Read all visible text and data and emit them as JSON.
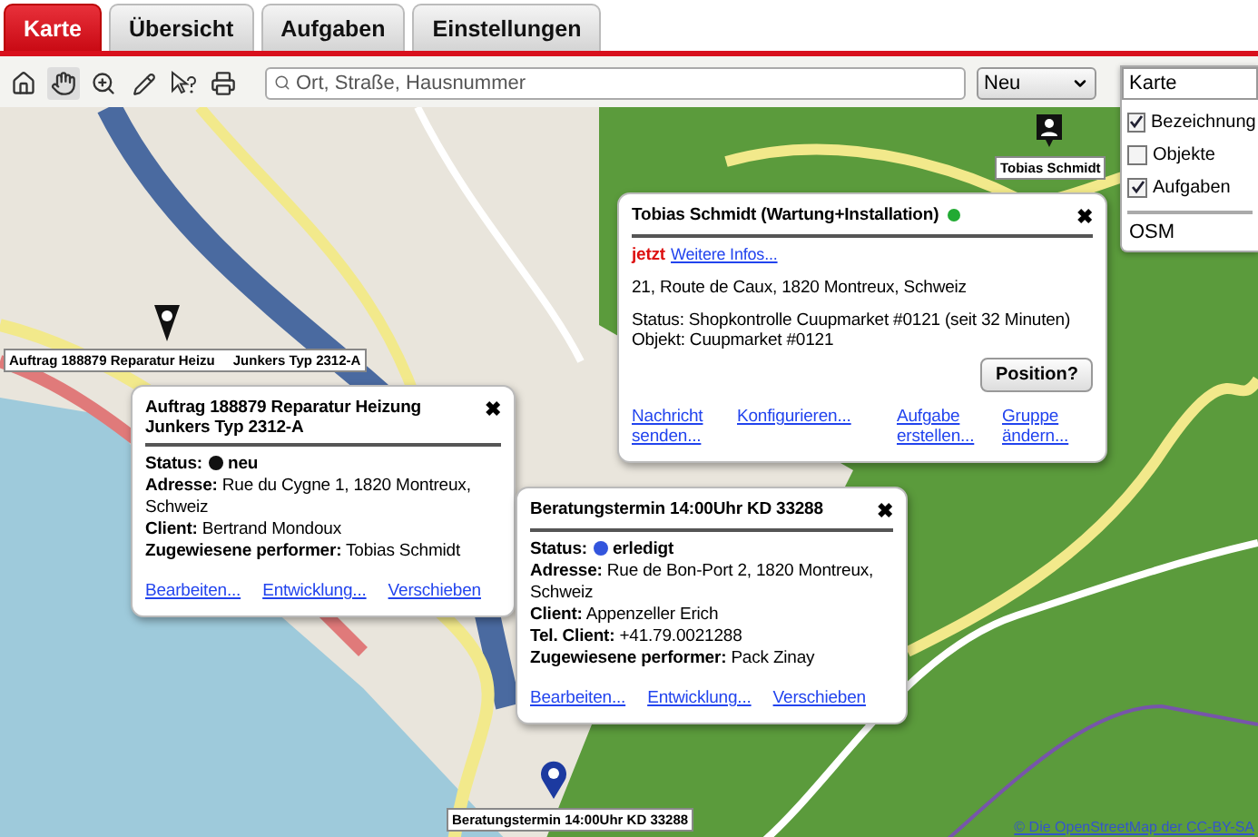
{
  "tabs": [
    {
      "label": "Karte",
      "selected": true
    },
    {
      "label": "Übersicht",
      "selected": false
    },
    {
      "label": "Aufgaben",
      "selected": false
    },
    {
      "label": "Einstellungen",
      "selected": false
    }
  ],
  "toolbar": {
    "search": {
      "placeholder": "Ort, Straße, Hausnummer"
    },
    "new_dropdown": "Neu"
  },
  "layers": {
    "map_select": "Karte",
    "options": [
      {
        "label": "Bezeichnung",
        "checked": true
      },
      {
        "label": "Objekte",
        "checked": false
      },
      {
        "label": "Aufgaben",
        "checked": true
      }
    ],
    "base_layer": "OSM"
  },
  "markers": [
    {
      "kind": "task",
      "label_parts": [
        "Auftrag 188879 Reparatur Heizu",
        "Junkers Typ 2312-A"
      ]
    },
    {
      "kind": "person",
      "label_parts": [
        "Tobias Schmidt"
      ]
    },
    {
      "kind": "done",
      "label_parts": [
        "Beratungstermin 14:00Uhr KD 33288"
      ]
    }
  ],
  "popups": [
    {
      "kind": "task",
      "title": "Auftrag 188879 Reparatur Heizung Junkers Typ 2312-A",
      "close": "✖",
      "fields": [
        {
          "kind": "status",
          "label": "Status:",
          "value": "neu",
          "color": "#111111"
        },
        {
          "kind": "text",
          "label": "Adresse:",
          "value": "Rue du Cygne 1, 1820 Montreux, Schweiz"
        },
        {
          "kind": "text",
          "label": "Client:",
          "value": "Bertrand Mondoux"
        },
        {
          "kind": "text",
          "label": "Zugewiesene performer:",
          "value": "Tobias Schmidt"
        }
      ],
      "links": [
        "Bearbeiten...",
        "Entwicklung...",
        "Verschieben"
      ]
    },
    {
      "kind": "done",
      "title": "Beratungstermin 14:00Uhr KD 33288",
      "close": "✖",
      "fields": [
        {
          "kind": "status",
          "label": "Status:",
          "value": "erledigt",
          "color": "#3355dd"
        },
        {
          "kind": "text",
          "label": "Adresse:",
          "value": "Rue de Bon-Port 2, 1820 Montreux, Schweiz"
        },
        {
          "kind": "text",
          "label": "Client:",
          "value": "Appenzeller Erich"
        },
        {
          "kind": "text",
          "label": "Tel. Client:",
          "value": "+41.79.0021288"
        },
        {
          "kind": "text",
          "label": "Zugewiesene performer:",
          "value": "Pack Zinay"
        }
      ],
      "links": [
        "Bearbeiten...",
        "Entwicklung...",
        "Verschieben"
      ]
    },
    {
      "kind": "person",
      "title": "Tobias Schmidt (Wartung+Installation)",
      "online": {
        "color": "#22aa33"
      },
      "close": "✖",
      "now": "jetzt",
      "more_link": "Weitere Infos...",
      "address": "21, Route de Caux, 1820 Montreux, Schweiz",
      "status_lines": [
        "Status: Shopkontrolle Cuupmarket #0121 (seit 32 Minuten)",
        "Objekt: Cuupmarket #0121"
      ],
      "button": "Position?",
      "links": [
        "Nachricht senden...",
        "Konfigurieren...",
        "Aufgabe erstellen...",
        "Gruppe ändern..."
      ]
    }
  ],
  "attribution": "© Die OpenStreetMap der CC-BY-SA"
}
